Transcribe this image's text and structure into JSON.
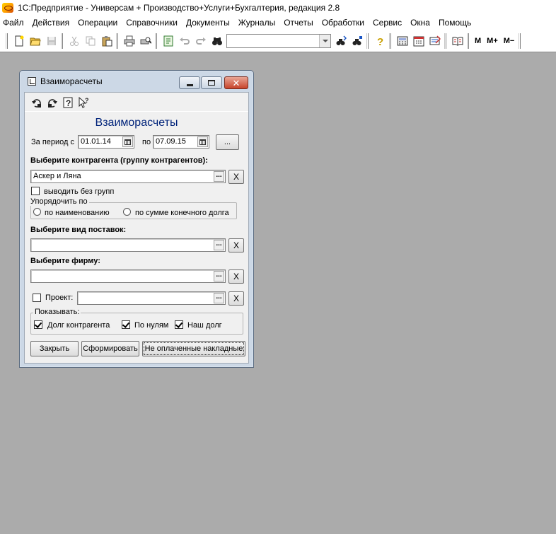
{
  "app": {
    "title": "1С:Предприятие - Универсам + Производство+Услуги+Бухгалтерия, редакция 2.8"
  },
  "menu": {
    "items": [
      "Файл",
      "Действия",
      "Операции",
      "Справочники",
      "Документы",
      "Журналы",
      "Отчеты",
      "Обработки",
      "Сервис",
      "Окна",
      "Помощь"
    ]
  },
  "toolbar": {
    "search_value": "",
    "m_label": "M",
    "mplus_label": "M+",
    "mminus_label": "M−"
  },
  "window": {
    "title": "Взаиморасчеты",
    "form_title": "Взаиморасчеты",
    "period_label": "За период с",
    "date_from": "01.01.14",
    "to_label": "по",
    "date_to": "07.09.15",
    "period_button": "...",
    "contractor_label": "Выберите контрагента (группу контрагентов):",
    "contractor_value": "Аскер и Ляна",
    "select_button": "...",
    "clear_button": "X",
    "no_groups_label": "выводить без групп",
    "no_groups_checked": false,
    "sort_group_label": "Упорядочить по",
    "sort_by_name_label": "по наименованию",
    "sort_by_debt_label": "по сумме конечного долга",
    "supply_type_label": "Выберите вид поставок:",
    "supply_type_value": "",
    "firm_label": "Выберите фирму:",
    "firm_value": "",
    "project_label": "Проект:",
    "project_value": "",
    "project_checked": false,
    "show_group_label": "Показывать:",
    "show_debt_contractor_label": "Долг контрагента",
    "show_debt_contractor_checked": true,
    "show_zero_label": "По нулям",
    "show_zero_checked": true,
    "show_our_debt_label": "Наш долг",
    "show_our_debt_checked": true,
    "close_button": "Закрыть",
    "build_button": "Сформировать",
    "unpaid_button": "Не оплаченные накладные"
  }
}
